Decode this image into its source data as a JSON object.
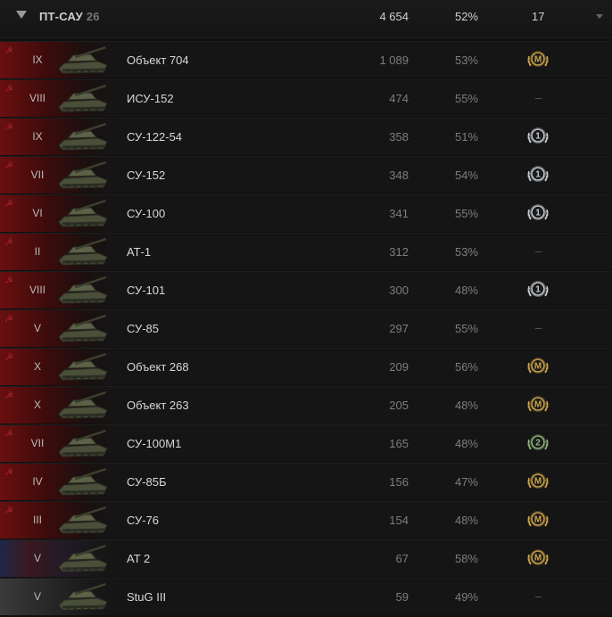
{
  "group": {
    "title": "ПТ-САУ",
    "count": "26",
    "battles": "4 654",
    "winrate": "52%",
    "masteries": "17"
  },
  "rows": [
    {
      "tier": "IX",
      "name": "Объект 704",
      "battles": "1 089",
      "winrate": "53%",
      "badge": "M",
      "nation": "ussr"
    },
    {
      "tier": "VIII",
      "name": "ИСУ-152",
      "battles": "474",
      "winrate": "55%",
      "badge": "–",
      "nation": "ussr"
    },
    {
      "tier": "IX",
      "name": "СУ-122-54",
      "battles": "358",
      "winrate": "51%",
      "badge": "1",
      "nation": "ussr"
    },
    {
      "tier": "VII",
      "name": "СУ-152",
      "battles": "348",
      "winrate": "54%",
      "badge": "1",
      "nation": "ussr"
    },
    {
      "tier": "VI",
      "name": "СУ-100",
      "battles": "341",
      "winrate": "55%",
      "badge": "1",
      "nation": "ussr"
    },
    {
      "tier": "II",
      "name": "АТ-1",
      "battles": "312",
      "winrate": "53%",
      "badge": "–",
      "nation": "ussr"
    },
    {
      "tier": "VIII",
      "name": "СУ-101",
      "battles": "300",
      "winrate": "48%",
      "badge": "1",
      "nation": "ussr"
    },
    {
      "tier": "V",
      "name": "СУ-85",
      "battles": "297",
      "winrate": "55%",
      "badge": "–",
      "nation": "ussr"
    },
    {
      "tier": "X",
      "name": "Объект 268",
      "battles": "209",
      "winrate": "56%",
      "badge": "M",
      "nation": "ussr"
    },
    {
      "tier": "X",
      "name": "Объект 263",
      "battles": "205",
      "winrate": "48%",
      "badge": "M",
      "nation": "ussr"
    },
    {
      "tier": "VII",
      "name": "СУ-100М1",
      "battles": "165",
      "winrate": "48%",
      "badge": "2",
      "nation": "ussr"
    },
    {
      "tier": "IV",
      "name": "СУ-85Б",
      "battles": "156",
      "winrate": "47%",
      "badge": "M",
      "nation": "ussr"
    },
    {
      "tier": "III",
      "name": "СУ-76",
      "battles": "154",
      "winrate": "48%",
      "badge": "M",
      "nation": "ussr"
    },
    {
      "tier": "V",
      "name": "AT 2",
      "battles": "67",
      "winrate": "58%",
      "badge": "M",
      "nation": "uk"
    },
    {
      "tier": "V",
      "name": "StuG III",
      "battles": "59",
      "winrate": "49%",
      "badge": "–",
      "nation": "germany"
    }
  ],
  "colors": {
    "mastery_gold": "#c9a24a",
    "class_silver": "#c4c8cc",
    "class_green": "#8fb07a"
  }
}
